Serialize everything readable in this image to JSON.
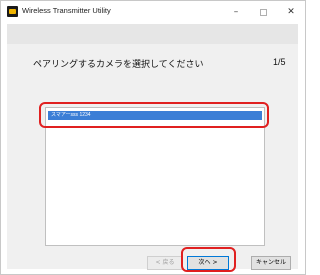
{
  "window": {
    "title": "Wireless Transmitter Utility",
    "controls": {
      "minimize": "–",
      "close": "✕"
    }
  },
  "wizard": {
    "heading": "ペアリングするカメラを選択してください",
    "page_indicator": "1/5",
    "camera_list": [
      "スマアーsss 1234"
    ],
    "buttons": {
      "back": "< 戻る",
      "next": "次へ >",
      "cancel": "キャンセル"
    }
  },
  "colors": {
    "selection": "#3b7ed6",
    "highlight": "#e02020"
  }
}
